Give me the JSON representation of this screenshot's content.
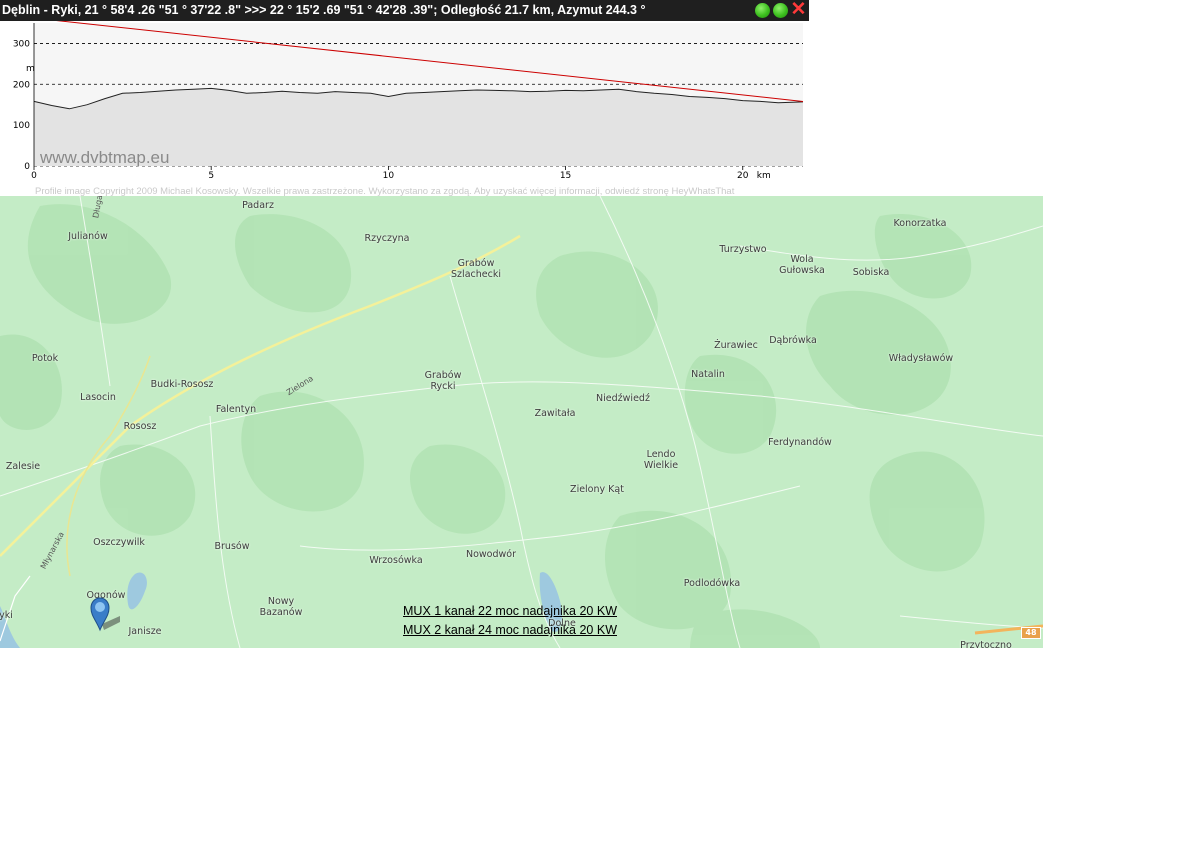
{
  "window": {
    "title": "Dęblin - Ryki, 21 ° 58'4 .26 \"51 ° 37'22 .8\" >>> 22 ° 15'2 .69 \"51 ° 42'28 .39\"; Odległość 21.7 km, Azymut 244.3 °",
    "close_glyph": "✕"
  },
  "profile": {
    "watermark": "www.dvbtmap.eu",
    "credit": "Profile image Copyright 2009 Michael Kosowsky. Wszelkie prawa zastrzeżone. Wykorzystano za zgodą. Aby uzyskać więcej informacji, odwiedź stronę HeyWhatsThat",
    "y_unit": "m",
    "x_unit": "km",
    "y_ticks": [
      "0",
      "100",
      "200",
      "300"
    ],
    "x_ticks": [
      "0",
      "5",
      "10",
      "15",
      "20"
    ],
    "colors": {
      "terrain": "#222222",
      "line_of_sight": "#cc0000",
      "fill": "#e3e3e3"
    }
  },
  "chart_data": {
    "type": "line",
    "xlabel": "km",
    "ylabel": "m",
    "xlim": [
      0,
      21.7
    ],
    "ylim": [
      0,
      350
    ],
    "grid": true,
    "series": [
      {
        "values_x": [
          0,
          0.5,
          1,
          1.5,
          2,
          2.5,
          3,
          3.5,
          4,
          4.5,
          5,
          5.5,
          6,
          6.5,
          7,
          7.5,
          8,
          8.5,
          9,
          9.5,
          10,
          10.5,
          11,
          11.5,
          12,
          12.5,
          13,
          13.5,
          14,
          14.5,
          15,
          15.5,
          16,
          16.5,
          17,
          17.5,
          18,
          18.5,
          19,
          19.5,
          20,
          20.5,
          21,
          21.7
        ],
        "values_y": [
          158,
          148,
          140,
          150,
          165,
          178,
          180,
          183,
          186,
          188,
          190,
          185,
          178,
          180,
          183,
          180,
          178,
          182,
          180,
          178,
          170,
          178,
          180,
          182,
          184,
          186,
          185,
          184,
          182,
          183,
          185,
          184,
          186,
          188,
          182,
          178,
          175,
          170,
          168,
          165,
          160,
          158,
          155,
          157
        ]
      },
      {
        "values_x": [
          0,
          21.7
        ],
        "values_y": [
          362,
          158
        ]
      }
    ]
  },
  "map": {
    "places": [
      {
        "name": "Padarz"
      },
      {
        "name": "Julianów"
      },
      {
        "name": "Rzyczyna"
      },
      {
        "name": "Grabów\nSzlachecki"
      },
      {
        "name": "Turzystwo"
      },
      {
        "name": "Wola\nGułowska"
      },
      {
        "name": "Sobiska"
      },
      {
        "name": "Konorzatka"
      },
      {
        "name": "Potok"
      },
      {
        "name": "Budki-Rososz"
      },
      {
        "name": "Lasocin"
      },
      {
        "name": "Falentyn"
      },
      {
        "name": "Rososz"
      },
      {
        "name": "Grabów\nRycki"
      },
      {
        "name": "Żurawiec"
      },
      {
        "name": "Dąbrówka"
      },
      {
        "name": "Natalin"
      },
      {
        "name": "Władysławów"
      },
      {
        "name": "Niedźwiedź"
      },
      {
        "name": "Zawitała"
      },
      {
        "name": "Ferdynandów"
      },
      {
        "name": "Lendo\nWielkie"
      },
      {
        "name": "Zalesie"
      },
      {
        "name": "Zielony Kąt"
      },
      {
        "name": "Oszczywilk"
      },
      {
        "name": "Brusów"
      },
      {
        "name": "Wrzosówka"
      },
      {
        "name": "Nowodwór"
      },
      {
        "name": "Podlodówka"
      },
      {
        "name": "Ogonów"
      },
      {
        "name": "Nowy\nBazanów"
      },
      {
        "name": "Janisze"
      },
      {
        "name": "Dolne"
      },
      {
        "name": "Przytoczno"
      },
      {
        "name": "yki"
      }
    ],
    "roads": [
      {
        "name": "Zielona"
      },
      {
        "name": "Młynarska"
      },
      {
        "name": "Długa"
      }
    ],
    "route_shield": "48",
    "marker_icon": "map-pin-icon",
    "transmitter_info": [
      "MUX 1 kanał 22  moc nadajnika 20 KW",
      "MUX 2 kanał 24  moc nadajnika 20 KW"
    ]
  }
}
